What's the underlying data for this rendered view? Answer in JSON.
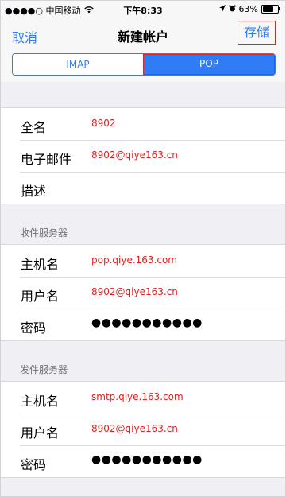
{
  "status_bar": {
    "carrier": "●●●●○ 中国移动",
    "time": "下午8:33",
    "battery": "63%",
    "battery_level": 0.63
  },
  "nav": {
    "cancel_label": "取消",
    "title": "新建帐户",
    "save_label": "存储"
  },
  "segments": {
    "imap_label": "IMAP",
    "pop_label": "POP",
    "selected": "POP"
  },
  "account": {
    "name_label": "全名",
    "name_value": "8902",
    "email_label": "电子邮件",
    "email_value": "8902@qiye163.cn",
    "desc_label": "描述",
    "desc_value": ""
  },
  "incoming": {
    "header": "收件服务器",
    "host_label": "主机名",
    "host_value": "pop.qiye.163.com",
    "user_label": "用户名",
    "user_value": "8902@qiye163.cn",
    "password_label": "密码",
    "password_value": "●●●●●●●●●●●"
  },
  "outgoing": {
    "header": "发件服务器",
    "host_label": "主机名",
    "host_value": "smtp.qiye.163.com",
    "user_label": "用户名",
    "user_value": "8902@qiye163.cn",
    "password_label": "密码",
    "password_value": "●●●●●●●●●●●"
  }
}
